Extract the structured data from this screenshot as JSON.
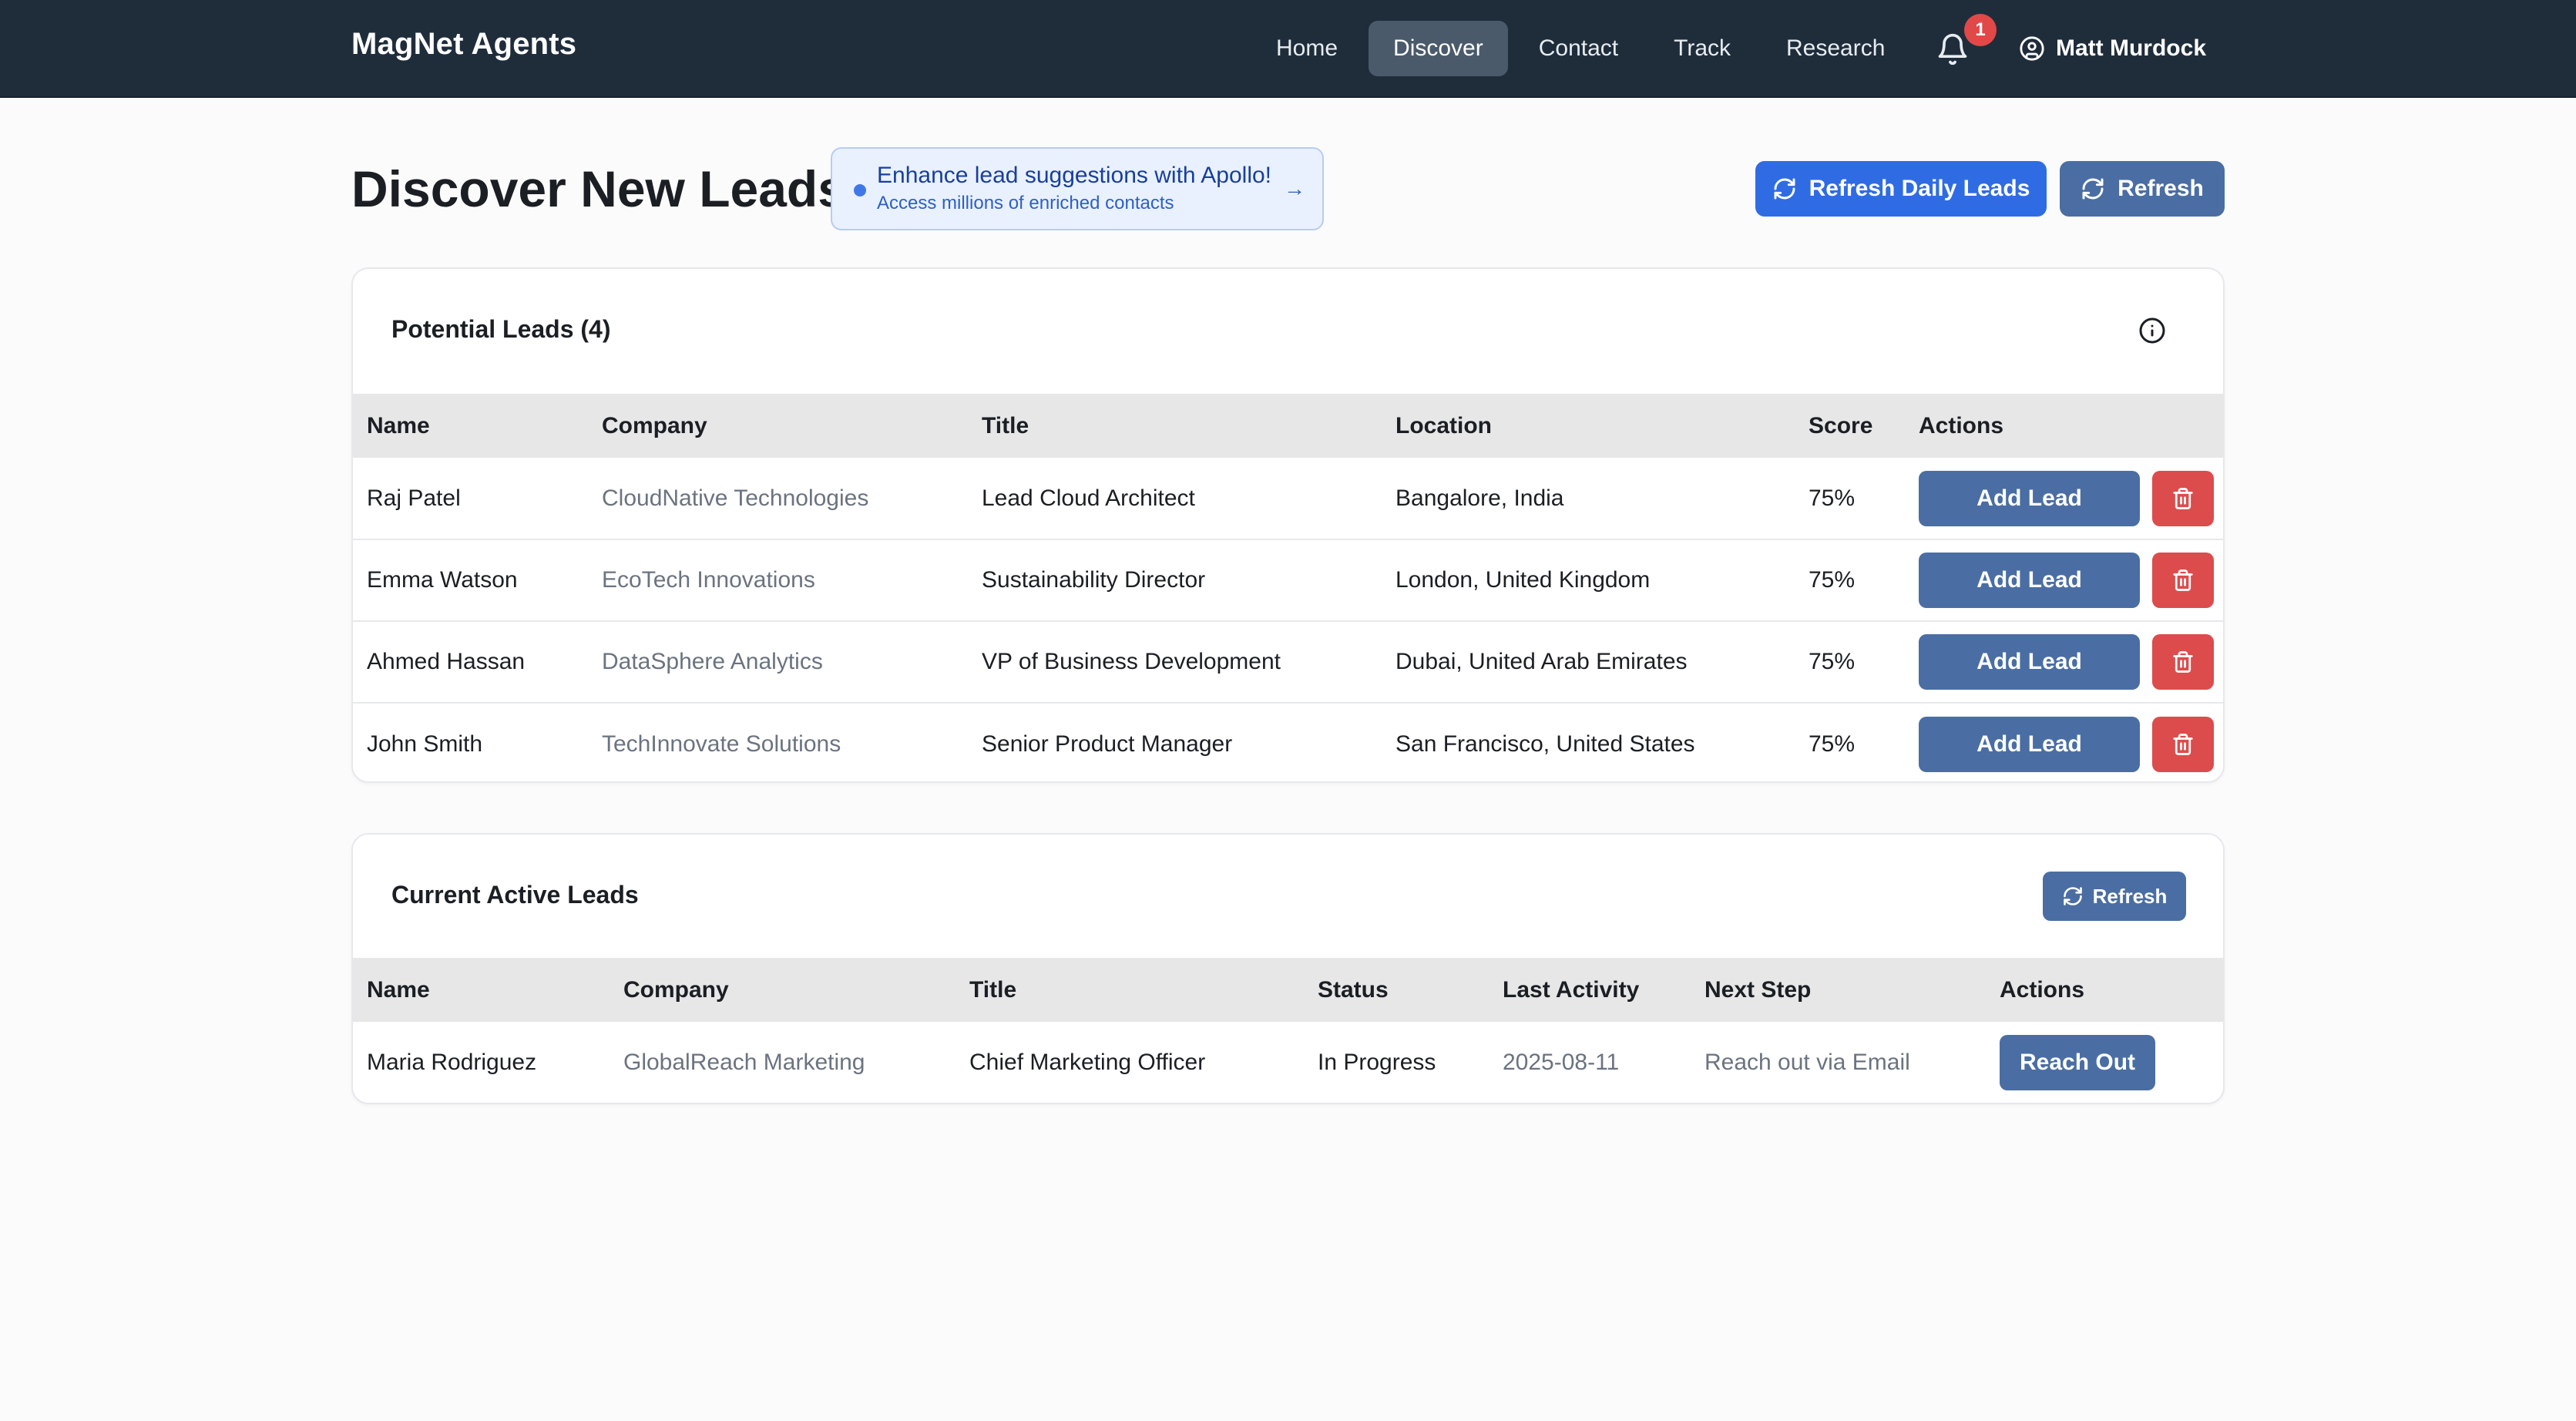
{
  "app": {
    "brand": "MagNet Agents"
  },
  "nav": {
    "items": [
      {
        "label": "Home"
      },
      {
        "label": "Discover"
      },
      {
        "label": "Contact"
      },
      {
        "label": "Track"
      },
      {
        "label": "Research"
      }
    ],
    "active": "Discover",
    "notifications_count": "1",
    "bell_icon": "bell-icon",
    "user_icon": "user-circle-icon",
    "user_name": "Matt Murdock"
  },
  "header": {
    "title": "Discover New Leads",
    "apollo_banner": {
      "title": "Enhance lead suggestions with Apollo!",
      "subtitle": "Access millions of enriched contacts",
      "arrow": "→"
    },
    "refresh_daily_label": "Refresh Daily Leads",
    "refresh_label": "Refresh"
  },
  "potential_leads": {
    "title": "Potential Leads (4)",
    "columns": [
      "Name",
      "Company",
      "Title",
      "Location",
      "Score",
      "Actions"
    ],
    "rows": [
      {
        "name": "Raj Patel",
        "company": "CloudNative Technologies",
        "title": "Lead Cloud Architect",
        "location": "Bangalore, India",
        "score": "75%"
      },
      {
        "name": "Emma Watson",
        "company": "EcoTech Innovations",
        "title": "Sustainability Director",
        "location": "London, United Kingdom",
        "score": "75%"
      },
      {
        "name": "Ahmed Hassan",
        "company": "DataSphere Analytics",
        "title": "VP of Business Development",
        "location": "Dubai, United Arab Emirates",
        "score": "75%"
      },
      {
        "name": "John Smith",
        "company": "TechInnovate Solutions",
        "title": "Senior Product Manager",
        "location": "San Francisco, United States",
        "score": "75%"
      }
    ],
    "add_lead_label": "Add Lead"
  },
  "active_leads": {
    "title": "Current Active Leads",
    "refresh_label": "Refresh",
    "columns": [
      "Name",
      "Company",
      "Title",
      "Status",
      "Last Activity",
      "Next Step",
      "Actions"
    ],
    "rows": [
      {
        "name": "Maria Rodriguez",
        "company": "GlobalReach Marketing",
        "title": "Chief Marketing Officer",
        "status": "In Progress",
        "last_activity": "2025-08-11",
        "next_step": "Reach out via Email"
      }
    ],
    "reach_out_label": "Reach Out"
  },
  "colors": {
    "topbar": "#1f2d3b",
    "primary_blue": "#2f6ce4",
    "slate_button": "#4a6ea3",
    "danger": "#dc4c4c"
  }
}
